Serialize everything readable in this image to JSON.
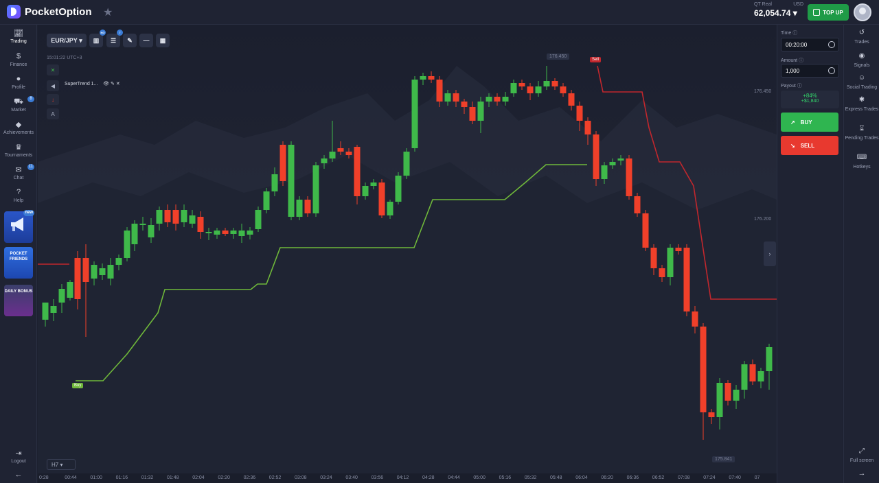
{
  "app": {
    "brand": "PocketOption"
  },
  "account": {
    "label": "QT Real",
    "currency": "USD",
    "balance": "62,054.74",
    "topup_label": "TOP UP"
  },
  "sidebar": {
    "items": [
      {
        "label": "Trading",
        "icon": "chart-icon"
      },
      {
        "label": "Finance",
        "icon": "dollar-icon"
      },
      {
        "label": "Profile",
        "icon": "user-icon"
      },
      {
        "label": "Market",
        "icon": "cart-icon",
        "badge": "8"
      },
      {
        "label": "Achievements",
        "icon": "diamond-icon"
      },
      {
        "label": "Tournaments",
        "icon": "trophy-icon"
      },
      {
        "label": "Chat",
        "icon": "chat-icon",
        "badge": "11"
      },
      {
        "label": "Help",
        "icon": "help-icon"
      }
    ],
    "promos": [
      {
        "label": "",
        "badge": "new"
      },
      {
        "label": "POCKET FRIENDS"
      },
      {
        "label": "DAILY BONUS"
      }
    ],
    "logout_label": "Logout"
  },
  "toolbar": {
    "pair": "EUR/JPY",
    "time": "15:01:22 UTC+3",
    "indicator": "SuperTrend 1...",
    "timeframe": "H7",
    "badge1": "NG",
    "badge2": "7"
  },
  "chart_overlays": {
    "top_price": "176.450",
    "bottom_price": "175.841",
    "sell_tag": "Sell",
    "buy_tag": "Buy",
    "grid_price_1": "176.450",
    "grid_price_2": "176.200"
  },
  "timeline": [
    "0:28",
    "00:44",
    "01:00",
    "01:16",
    "01:32",
    "01:48",
    "02:04",
    "02:20",
    "02:36",
    "02:52",
    "03:08",
    "03:24",
    "03:40",
    "03:56",
    "04:12",
    "04:28",
    "04:44",
    "05:00",
    "05:16",
    "05:32",
    "05:48",
    "06:04",
    "06:20",
    "06:36",
    "06:52",
    "07:08",
    "07:24",
    "07:40",
    "07"
  ],
  "trade_panel": {
    "time_label": "Time",
    "time_value": "00:20:00",
    "amount_label": "Amount",
    "amount_value": "1,000",
    "payout_label": "Payout",
    "payout_pct": "+84%",
    "payout_amt": "+$1,840",
    "buy_label": "BUY",
    "sell_label": "SELL"
  },
  "right_nav": [
    {
      "label": "Trades",
      "icon": "history-icon"
    },
    {
      "label": "Signals",
      "icon": "signals-icon"
    },
    {
      "label": "Social Trading",
      "icon": "social-icon"
    },
    {
      "label": "Express Trades",
      "icon": "express-icon"
    },
    {
      "label": "Pending Trades",
      "icon": "hourglass-icon"
    },
    {
      "label": "Hotkeys",
      "icon": "keyboard-icon"
    }
  ],
  "fullscreen_label": "Full screen",
  "colors": {
    "up": "#3fb94a",
    "down": "#f0402a",
    "supertrend_up": "#6fb83a",
    "supertrend_down": "#c2272d"
  }
}
